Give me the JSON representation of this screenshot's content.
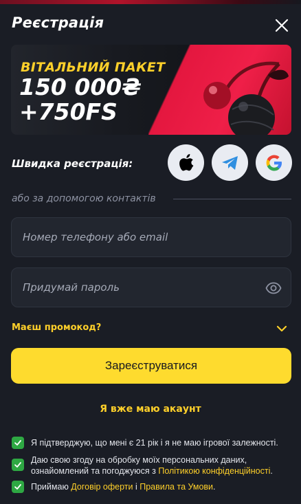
{
  "header": {
    "title": "Реєстрація"
  },
  "banner": {
    "line1": "ВІТАЛЬНИЙ ПАКЕТ",
    "line2": "150 000₴",
    "line3": "+750FS"
  },
  "quick_registration": {
    "label": "Швидка реєстрація:",
    "providers": [
      {
        "name": "apple-icon"
      },
      {
        "name": "telegram-icon"
      },
      {
        "name": "google-icon"
      }
    ]
  },
  "contacts": {
    "label": "або за допомогою контактів"
  },
  "form": {
    "login_placeholder": "Номер телефону або email",
    "login_value": "",
    "password_placeholder": "Придумай пароль",
    "password_value": "",
    "promo_label": "Маєш промокод?",
    "submit_label": "Зареєструватися",
    "have_account_label": "Я вже маю акаунт"
  },
  "consents": [
    {
      "checked": true,
      "text": "Я підтверджую, що мені є 21 рік і я не маю ігрової залежності."
    },
    {
      "checked": true,
      "text_before": "Даю свою згоду на обробку моїх персональних даних, ознайомлений та погоджуюся з ",
      "link": "Політикою конфіденційності",
      "text_after": "."
    },
    {
      "checked": true,
      "text_before": "Приймаю ",
      "link1": "Договір оферти",
      "middle": " і ",
      "link2": "Правила та Умови",
      "text_after": "."
    }
  ],
  "colors": {
    "accent": "#fedb2e",
    "background": "#1a1d25",
    "input": "#22262f",
    "check": "#2ea843",
    "banner_red": "#ef1f48"
  }
}
